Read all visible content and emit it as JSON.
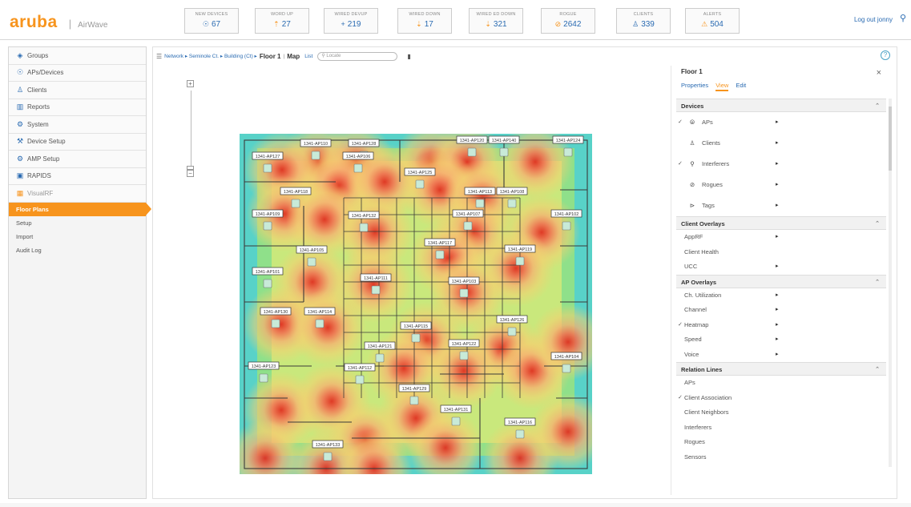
{
  "app": {
    "brand": "aruba",
    "product": "AirWave",
    "logout": "Log out jonny"
  },
  "stats": [
    {
      "label": "NEW DEVICES",
      "value": "67",
      "icon": "devices-icon",
      "kind": "plain"
    },
    {
      "label": "WORD UP",
      "value": "27",
      "icon": "up-arrow-icon",
      "kind": "up"
    },
    {
      "label": "WIRED DEVUP",
      "value": "219",
      "icon": "plus-icon",
      "kind": "plain"
    },
    {
      "label": "WIRED DOWN",
      "value": "17",
      "icon": "down-arrow-icon",
      "kind": "up"
    },
    {
      "label": "WIRED ED DOWN",
      "value": "321",
      "icon": "down-arrow-icon",
      "kind": "down"
    },
    {
      "label": "ROGUE",
      "value": "2642",
      "icon": "rogue-icon",
      "kind": "down"
    },
    {
      "label": "CLIENTS",
      "value": "339",
      "icon": "clients-icon",
      "kind": "plain"
    },
    {
      "label": "ALERTS",
      "value": "504",
      "icon": "warning-icon",
      "kind": "warn"
    }
  ],
  "sidebar": {
    "items": [
      {
        "label": "Groups",
        "icon": "groups-icon"
      },
      {
        "label": "APs/Devices",
        "icon": "devices-icon"
      },
      {
        "label": "Clients",
        "icon": "clients-icon"
      },
      {
        "label": "Reports",
        "icon": "reports-icon"
      },
      {
        "label": "System",
        "icon": "system-icon"
      },
      {
        "label": "Device Setup",
        "icon": "device-setup-icon"
      },
      {
        "label": "AMP Setup",
        "icon": "amp-setup-icon"
      },
      {
        "label": "RAPIDS",
        "icon": "rapids-icon"
      },
      {
        "label": "VisualRF",
        "icon": "visualrf-icon"
      }
    ],
    "subitems": [
      {
        "label": "Floor Plans",
        "active": true
      },
      {
        "label": "Setup",
        "active": false
      },
      {
        "label": "Import",
        "active": false
      },
      {
        "label": "Audit Log",
        "active": false
      }
    ]
  },
  "breadcrumb": {
    "path": "Network ▸ Seminole Ct. ▸ Building (Ct) ▸",
    "current": "Floor 1",
    "map": "Map",
    "list": "List",
    "search_placeholder": "Locate"
  },
  "panel": {
    "title": "Floor 1",
    "tabs": [
      {
        "label": "Properties",
        "on": false
      },
      {
        "label": "View",
        "on": true
      },
      {
        "label": "Edit",
        "on": false
      }
    ],
    "sections": [
      {
        "title": "Devices",
        "rows": [
          {
            "label": "APs",
            "checked": true,
            "icon": "ap-icon",
            "arrow": true,
            "tall": true
          },
          {
            "label": "Clients",
            "checked": false,
            "icon": "clients-icon",
            "arrow": true,
            "tall": true
          },
          {
            "label": "Interferers",
            "checked": true,
            "icon": "interferer-icon",
            "arrow": true,
            "tall": true
          },
          {
            "label": "Rogues",
            "checked": false,
            "icon": "rogue-icon",
            "arrow": true,
            "tall": true
          },
          {
            "label": "Tags",
            "checked": false,
            "icon": "tag-icon",
            "arrow": true,
            "tall": true
          }
        ]
      },
      {
        "title": "Client Overlays",
        "rows": [
          {
            "label": "AppRF",
            "checked": false,
            "arrow": true
          },
          {
            "label": "Client Health",
            "checked": false,
            "arrow": false
          },
          {
            "label": "UCC",
            "checked": false,
            "arrow": true
          }
        ]
      },
      {
        "title": "AP Overlays",
        "rows": [
          {
            "label": "Ch. Utilization",
            "checked": false,
            "arrow": true
          },
          {
            "label": "Channel",
            "checked": false,
            "arrow": true
          },
          {
            "label": "Heatmap",
            "checked": true,
            "arrow": true
          },
          {
            "label": "Speed",
            "checked": false,
            "arrow": true
          },
          {
            "label": "Voice",
            "checked": false,
            "arrow": true
          }
        ]
      },
      {
        "title": "Relation Lines",
        "rows": [
          {
            "label": "APs",
            "checked": false,
            "arrow": false
          },
          {
            "label": "Client Association",
            "checked": true,
            "arrow": false
          },
          {
            "label": "Client Neighbors",
            "checked": false,
            "arrow": false
          },
          {
            "label": "Interferers",
            "checked": false,
            "arrow": false
          },
          {
            "label": "Rogues",
            "checked": false,
            "arrow": false
          },
          {
            "label": "Sensors",
            "checked": false,
            "arrow": false
          }
        ]
      }
    ]
  },
  "aps": [
    {
      "label": "1341-AP110"
    },
    {
      "label": "1341-AP128"
    },
    {
      "label": "1341-AP120"
    },
    {
      "label": "1341-AP140"
    },
    {
      "label": "1341-AP124"
    },
    {
      "label": "1341-AP127"
    },
    {
      "label": "1341-AP106"
    },
    {
      "label": "1341-AP125"
    },
    {
      "label": "1341-AP118"
    },
    {
      "label": "1341-AP113"
    },
    {
      "label": "1341-AP108"
    },
    {
      "label": "1341-AP109"
    },
    {
      "label": "1341-AP132"
    },
    {
      "label": "1341-AP107"
    },
    {
      "label": "1341-AP102"
    },
    {
      "label": "1341-AP117"
    },
    {
      "label": "1341-AP119"
    },
    {
      "label": "1341-AP105"
    },
    {
      "label": "1341-AP111"
    },
    {
      "label": "1341-AP103"
    },
    {
      "label": "1341-AP101"
    },
    {
      "label": "1341-AP130"
    },
    {
      "label": "1341-AP114"
    },
    {
      "label": "1341-AP115"
    },
    {
      "label": "1341-AP126"
    },
    {
      "label": "1341-AP121"
    },
    {
      "label": "1341-AP122"
    },
    {
      "label": "1341-AP104"
    },
    {
      "label": "1341-AP123"
    },
    {
      "label": "1341-AP112"
    },
    {
      "label": "1341-AP129"
    },
    {
      "label": "1341-AP131"
    },
    {
      "label": "1341-AP116"
    },
    {
      "label": "1341-AP133"
    }
  ]
}
